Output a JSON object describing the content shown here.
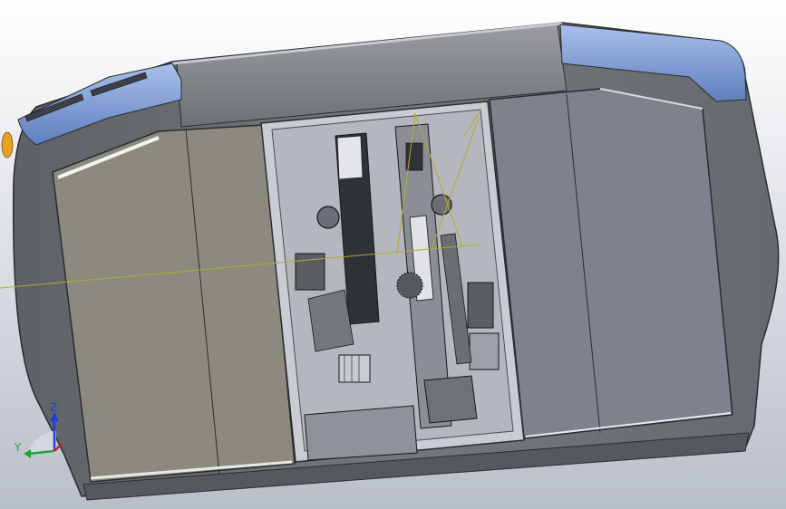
{
  "viewport": {
    "background_top": "#ffffff",
    "background_bottom": "#b9bfc9"
  },
  "colors": {
    "body_gray": "#6f7276",
    "body_dark": "#55585c",
    "accent_blue": "#6f8fc9",
    "accent_blue_light": "#a9c0ea",
    "panel_left": "#8c8a7f",
    "panel_right": "#7f828c",
    "interior": "#9a9da3",
    "edge": "#2a2c30",
    "sketch_line": "#b5ac2a",
    "indicator_orange": "#e8a020"
  },
  "triad": {
    "z_label": "Z",
    "y_label": "Y",
    "z_color": "#1f3fe0",
    "y_color": "#1ea53a",
    "x_color": "#d01a1a"
  }
}
